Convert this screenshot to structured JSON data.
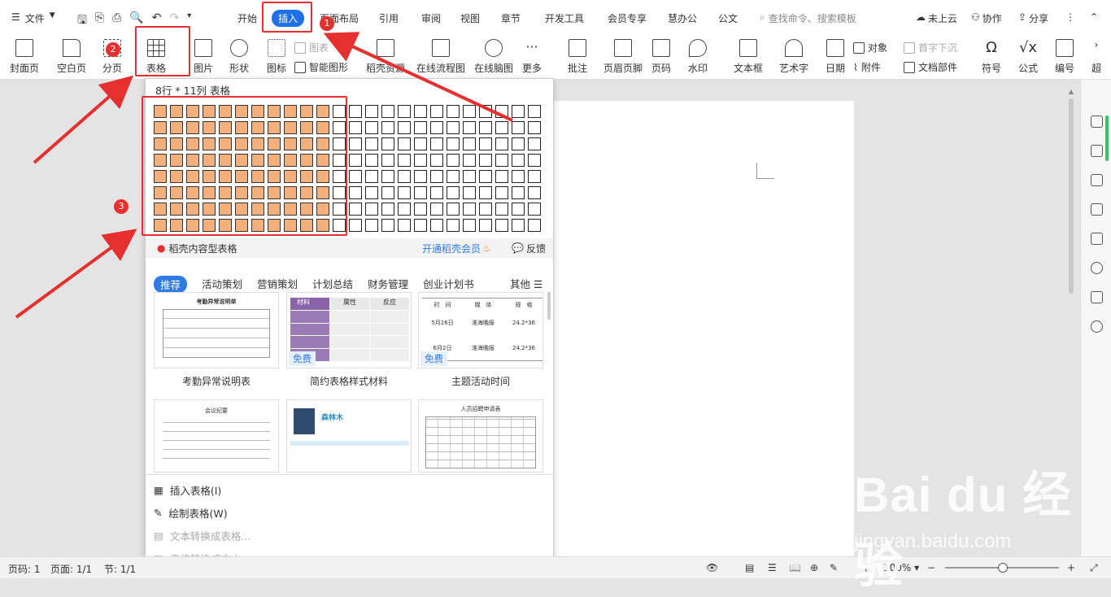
{
  "menu": {
    "file": "文件",
    "tabs": [
      "开始",
      "插入",
      "页面布局",
      "引用",
      "审阅",
      "视图",
      "章节",
      "开发工具",
      "会员专享",
      "慧办公",
      "公文"
    ],
    "search": "查找命令、搜索模板",
    "cloud": "未上云",
    "collab": "协作",
    "share": "分享"
  },
  "ribbon": {
    "cover": "封面页",
    "blank": "空白页",
    "pagebreak": "分页",
    "table": "表格",
    "picture": "图片",
    "shape": "形状",
    "icon": "图标",
    "chart": "图表",
    "smartart": "智能图形",
    "straw": "稻壳资源",
    "flow": "在线流程图",
    "mind": "在线脑图",
    "more": "更多",
    "comment": "批注",
    "headerfooter": "页眉页脚",
    "pagenum": "页码",
    "watermark": "水印",
    "textbox": "文本框",
    "wordart": "艺术字",
    "date": "日期",
    "object": "对象",
    "attach": "附件",
    "dropcap": "首字下沉",
    "docpart": "文档部件",
    "symbol": "符号",
    "formula": "公式",
    "numbering": "编号",
    "overflow": "超"
  },
  "badges": [
    "1",
    "2",
    "3"
  ],
  "dropdown": {
    "grid_title": "8行 * 11列 表格",
    "selected_rows": 8,
    "selected_cols": 11,
    "total_rows": 8,
    "total_cols": 24,
    "template_header": "稻壳内容型表格",
    "member": "开通稻壳会员",
    "feedback": "反馈",
    "categories": [
      "推荐",
      "活动策划",
      "营销策划",
      "计划总结",
      "财务管理",
      "创业计划书"
    ],
    "other": "其他",
    "templates": [
      {
        "label": "考勤异常说明表",
        "free": ""
      },
      {
        "label": "简约表格样式材料",
        "free": "免费"
      },
      {
        "label": "主题活动时间",
        "free": "免费"
      }
    ],
    "tpl_texts": {
      "t1_title": "考勤异常说明单",
      "t2_head": [
        "材料",
        "属性",
        "反应"
      ],
      "t3_head": [
        "时　间",
        "媒　体",
        "规　格"
      ],
      "t3_rows": [
        [
          "5月26日",
          "淮海晚报",
          "24.2*36"
        ],
        [
          "6月2日",
          "淮海晚报",
          "24.2*36"
        ]
      ],
      "t4_title": "会议纪要",
      "t5_name": "森林木",
      "t6_title": "人员招聘申请表"
    },
    "actions": [
      {
        "label": "插入表格(I)",
        "enabled": true
      },
      {
        "label": "绘制表格(W)",
        "enabled": true
      },
      {
        "label": "文本转换成表格...",
        "enabled": false
      },
      {
        "label": "表格转换成文本...",
        "enabled": false
      }
    ]
  },
  "status": {
    "page": "页码: 1",
    "pages": "页面: 1/1",
    "section": "节: 1/1",
    "zoom": "100%",
    "zoom_minus": "−",
    "zoom_plus": "+"
  },
  "watermark": {
    "main": "Bai du 经验",
    "url": "jingyan.baidu.com"
  },
  "colors": {
    "accent": "#1f6feb",
    "selected_cell": "#f4b07c",
    "annotation": "#e5302f"
  }
}
